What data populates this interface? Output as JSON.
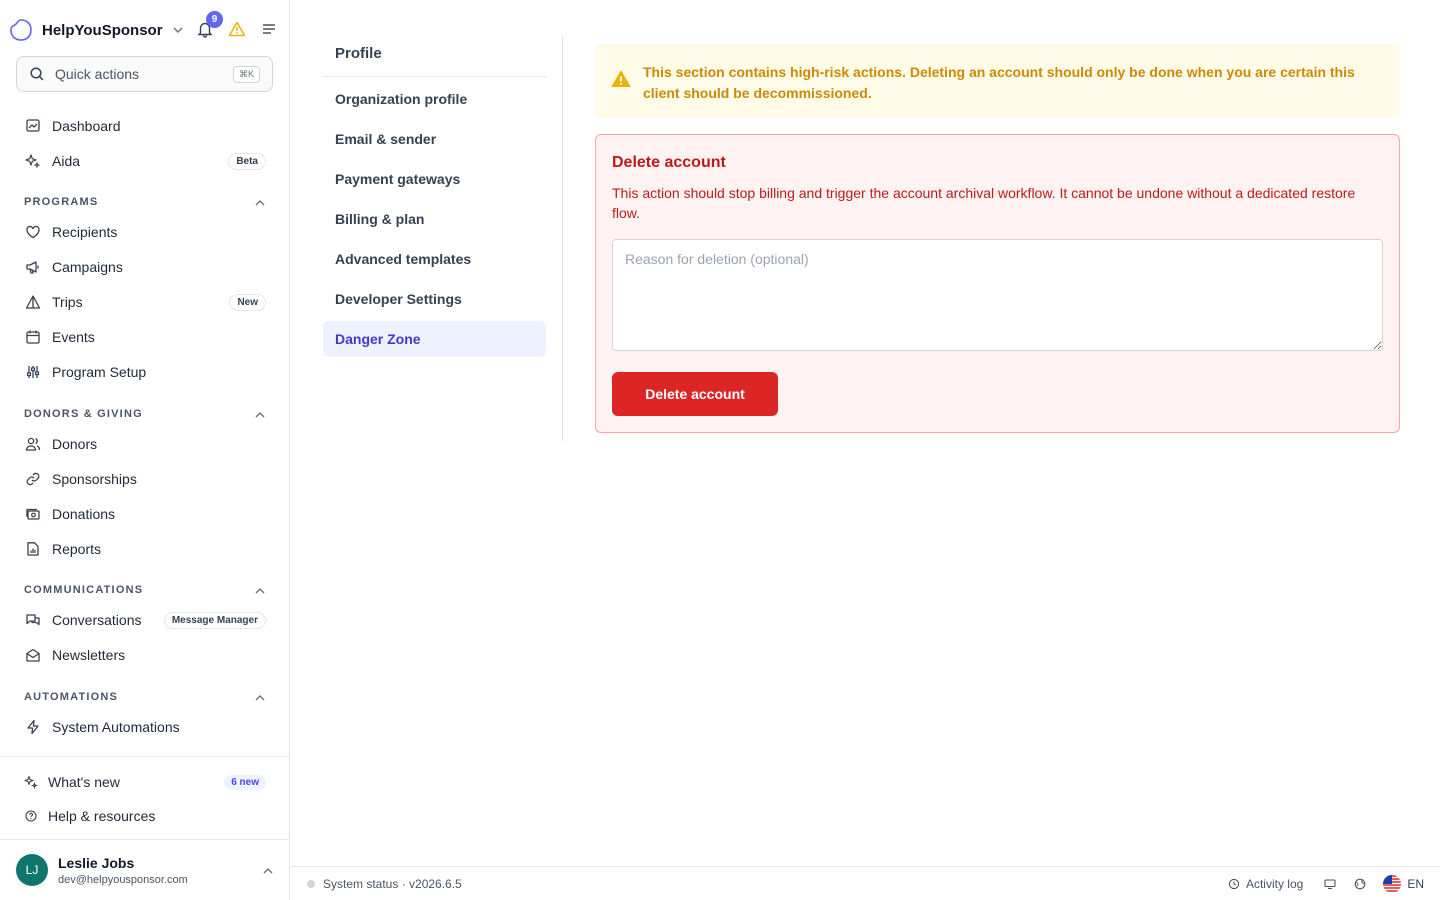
{
  "brand": {
    "name": "HelpYouSponsor"
  },
  "notifications": {
    "count": "9"
  },
  "search": {
    "placeholder": "Quick actions",
    "shortcut": "⌘K"
  },
  "nav_top": [
    {
      "label": "Dashboard",
      "icon": "dashboard-icon"
    },
    {
      "label": "Aida",
      "icon": "sparkles-icon",
      "tag": "Beta"
    }
  ],
  "sections": {
    "programs": {
      "title": "PROGRAMS",
      "items": [
        {
          "label": "Recipients",
          "icon": "heart-icon"
        },
        {
          "label": "Campaigns",
          "icon": "megaphone-icon"
        },
        {
          "label": "Trips",
          "icon": "triangle-icon",
          "tag": "New"
        },
        {
          "label": "Events",
          "icon": "calendar-icon"
        },
        {
          "label": "Program Setup",
          "icon": "sliders-icon"
        }
      ]
    },
    "donors": {
      "title": "DONORS & GIVING",
      "items": [
        {
          "label": "Donors",
          "icon": "users-icon"
        },
        {
          "label": "Sponsorships",
          "icon": "link-icon"
        },
        {
          "label": "Donations",
          "icon": "cash-icon"
        },
        {
          "label": "Reports",
          "icon": "report-icon"
        }
      ]
    },
    "communications": {
      "title": "COMMUNICATIONS",
      "items": [
        {
          "label": "Conversations",
          "icon": "chat-icon",
          "tag": "Message Manager"
        },
        {
          "label": "Newsletters",
          "icon": "envelope-open-icon"
        }
      ]
    },
    "automations": {
      "title": "AUTOMATIONS",
      "items": [
        {
          "label": "System Automations",
          "icon": "bolt-icon"
        }
      ]
    }
  },
  "bottom": {
    "whats_new": "What's new",
    "whats_new_tag": "6 new",
    "help": "Help & resources"
  },
  "user": {
    "initials": "LJ",
    "name": "Leslie Jobs",
    "email": "dev@helpyousponsor.com"
  },
  "settings_nav": {
    "header": "Profile",
    "items": [
      "Organization profile",
      "Email & sender",
      "Payment gateways",
      "Billing & plan",
      "Advanced templates",
      "Developer Settings",
      "Danger Zone"
    ],
    "active": "Danger Zone"
  },
  "warning": {
    "text": "This section contains high-risk actions. Deleting an account should only be done when you are certain this client should be decommissioned."
  },
  "delete_account": {
    "title": "Delete account",
    "description": "This action should stop billing and trigger the account archival workflow. It cannot be undone without a dedicated restore flow.",
    "reason_placeholder": "Reason for deletion (optional)",
    "reason_value": "",
    "button": "Delete account"
  },
  "footer": {
    "status": "System status · v2026.6.5",
    "activity_log": "Activity log",
    "language": "EN"
  },
  "colors": {
    "accent": "#6366f1",
    "danger": "#dc2626",
    "warning": "#ca8a04"
  }
}
